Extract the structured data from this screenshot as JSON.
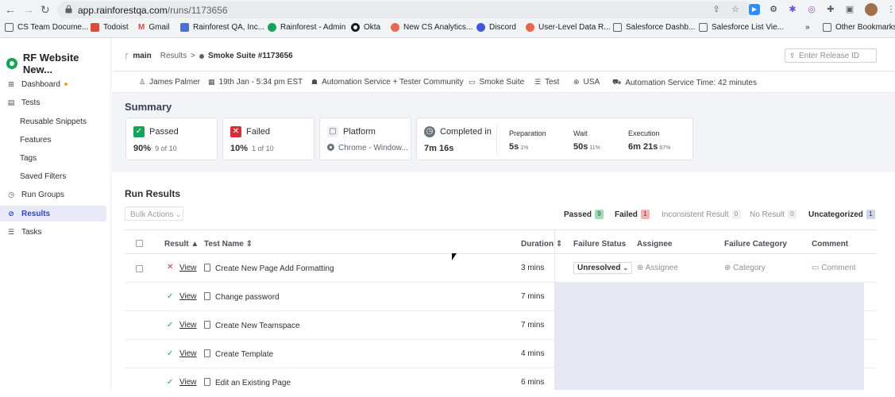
{
  "browser": {
    "url_host": "app.rainforestqa.com",
    "url_path": "/runs/1173656",
    "bookmarks": [
      "CS Team Docume...",
      "Todoist",
      "Gmail",
      "Rainforest QA, Inc...",
      "Rainforest - Admin",
      "Okta",
      "New CS Analytics...",
      "Discord",
      "User-Level Data R...",
      "Salesforce Dashb...",
      "Salesforce List Vie..."
    ],
    "more_bookmarks": "»",
    "other_bookmarks": "Other Bookmarks"
  },
  "sidebar": {
    "app_title": "RF Website New...",
    "items": [
      {
        "label": "Dashboard",
        "icon": "dashboard-icon"
      },
      {
        "label": "Tests",
        "icon": "tests-icon"
      },
      {
        "label": "Reusable Snippets"
      },
      {
        "label": "Features"
      },
      {
        "label": "Tags"
      },
      {
        "label": "Saved Filters"
      },
      {
        "label": "Run Groups",
        "icon": "clock-icon"
      },
      {
        "label": "Results",
        "icon": "results-icon",
        "active": true
      },
      {
        "label": "Tasks",
        "icon": "tasks-icon"
      }
    ]
  },
  "header": {
    "branch": "main",
    "crumb_results": "Results",
    "separator": ">",
    "suite": "Smoke Suite #1173656",
    "release_placeholder": "Enter Release ID"
  },
  "meta": {
    "user": "James Palmer",
    "date": "19th Jan - 5:34 pm EST",
    "service": "Automation Service + Tester Community",
    "suite": "Smoke Suite",
    "env": "Test",
    "region": "USA",
    "service_time": "Automation Service Time: 42 minutes"
  },
  "summary": {
    "title": "Summary",
    "passed": {
      "label": "Passed",
      "value": "90%",
      "sub": "9 of 10"
    },
    "failed": {
      "label": "Failed",
      "value": "10%",
      "sub": "1 of 10"
    },
    "platform": {
      "label": "Platform",
      "value": "Chrome - Window..."
    },
    "completed": {
      "label": "Completed in",
      "value": "7m 16s"
    },
    "preparation": {
      "label": "Preparation",
      "value": "5s",
      "pct": "1%"
    },
    "wait": {
      "label": "Wait",
      "value": "50s",
      "pct": "11%"
    },
    "execution": {
      "label": "Execution",
      "value": "6m 21s",
      "pct": "87%"
    }
  },
  "results": {
    "title": "Run Results",
    "bulk_actions": "Bulk Actions",
    "filters": [
      {
        "label": "Passed",
        "count": "9"
      },
      {
        "label": "Failed",
        "count": "1"
      },
      {
        "label": "Inconsistent Result",
        "count": "0"
      },
      {
        "label": "No Result",
        "count": "0"
      },
      {
        "label": "Uncategorized",
        "count": "1"
      }
    ],
    "columns": {
      "result": "Result ▲",
      "test_name": "Test Name ⇕",
      "duration": "Duration ⇕",
      "failure_status": "Failure Status",
      "assignee": "Assignee",
      "failure_category": "Failure Category",
      "comment": "Comment"
    },
    "rows": [
      {
        "status": "failed",
        "view": "View",
        "name": "Create New Page Add Formatting",
        "duration": "3 mins",
        "failure_status": "Unresolved",
        "assignee": "Assignee",
        "category": "Category",
        "comment": "Comment"
      },
      {
        "status": "passed",
        "view": "View",
        "name": "Change password",
        "duration": "7 mins"
      },
      {
        "status": "passed",
        "view": "View",
        "name": "Create New Teamspace",
        "duration": "7 mins"
      },
      {
        "status": "passed",
        "view": "View",
        "name": "Create Template",
        "duration": "4 mins"
      },
      {
        "status": "passed",
        "view": "View",
        "name": "Edit an Existing Page",
        "duration": "6 mins"
      }
    ]
  },
  "colors": {
    "passed": "#19a35a",
    "failed": "#d32f3a",
    "active": "#3046c8"
  }
}
